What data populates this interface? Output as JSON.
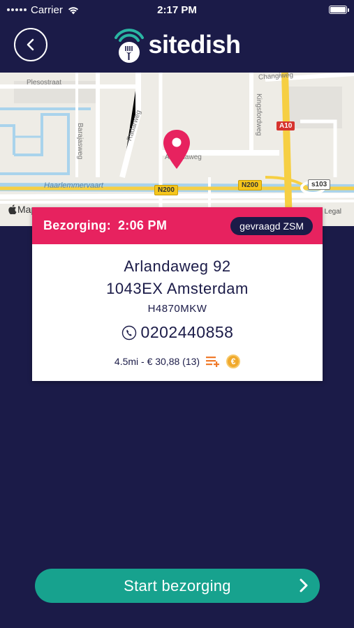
{
  "status_bar": {
    "carrier": "Carrier",
    "time": "2:17 PM"
  },
  "header": {
    "logo_text": "sitedish",
    "back_icon": "chevron-left-icon"
  },
  "map": {
    "labels": {
      "plesostraat": "Plesostraat",
      "changiweg": "Changiweg",
      "barajasweg": "Barajasweg",
      "radarweg": "Radarweg",
      "kingsfordweg": "Kingsfordweg",
      "arlandaweg": "Arlandaweg",
      "haarlemmervaart": "Haarlemmervaart"
    },
    "road_badges": {
      "a10": "A10",
      "n200_left": "N200",
      "n200_right": "N200",
      "s103": "s103"
    },
    "attribution": "Maps",
    "legal": "Legal"
  },
  "order": {
    "header_label": "Bezorging:",
    "header_time": "2:06 PM",
    "badge": "gevraagd ZSM",
    "address_line1": "Arlandaweg 92",
    "address_line2": "1043EX Amsterdam",
    "code": "H4870MKW",
    "phone": "0202440858",
    "meta": "4.5mi - € 30,88 (13)"
  },
  "actions": {
    "start_label": "Start bezorging"
  },
  "colors": {
    "background": "#1b1b48",
    "accent_pink": "#e7225f",
    "accent_teal": "#17a28e",
    "logo_teal": "#2ab5a3",
    "euro_orange": "#f0a92c"
  }
}
